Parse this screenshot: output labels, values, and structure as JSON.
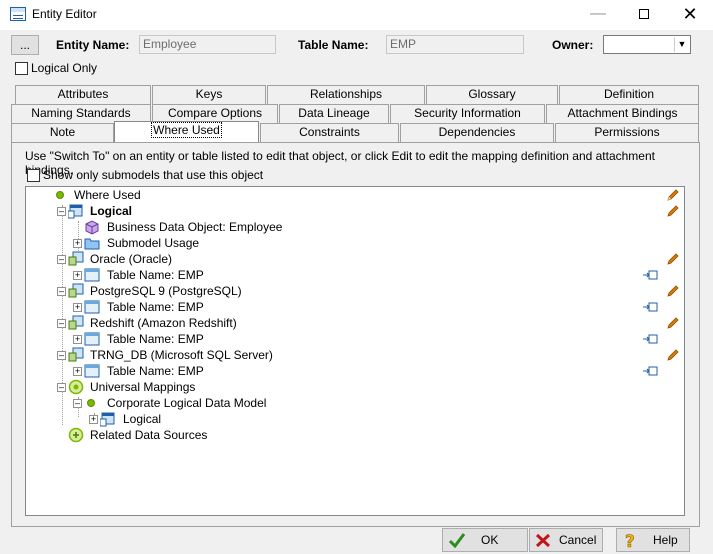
{
  "window": {
    "title": "Entity Editor"
  },
  "header": {
    "browse_label": "...",
    "entity_name_label": "Entity Name:",
    "entity_name_value": "Employee",
    "table_name_label": "Table Name:",
    "table_name_value": "EMP",
    "owner_label": "Owner:",
    "owner_value": "",
    "logical_only_label": "Logical Only"
  },
  "tabs": {
    "row1": [
      "Attributes",
      "Keys",
      "Relationships",
      "Glossary",
      "Definition"
    ],
    "row2": [
      "Naming Standards",
      "Compare Options",
      "Data Lineage",
      "Security Information",
      "Attachment Bindings"
    ],
    "row3": [
      "Note",
      "Where Used",
      "Constraints",
      "Dependencies",
      "Permissions"
    ],
    "active": "Where Used"
  },
  "panel": {
    "hint": "Use \"Switch To\" on an entity or table listed to edit that object, or click Edit to edit the mapping definition and attachment bindings.",
    "show_submodels_label": "Show only submodels that use this object"
  },
  "tree": [
    "Where Used",
    "Logical",
    "Business Data Object: Employee",
    "Submodel Usage",
    "Oracle (Oracle)",
    "Table Name: EMP",
    "PostgreSQL 9 (PostgreSQL)",
    "Table Name: EMP",
    "Redshift (Amazon Redshift)",
    "Table Name: EMP",
    "TRNG_DB (Microsoft SQL Server)",
    "Table Name: EMP",
    "Universal Mappings",
    "Corporate Logical Data Model",
    "Logical",
    "Related Data Sources"
  ],
  "footer": {
    "ok": "OK",
    "cancel": "Cancel",
    "help": "Help"
  },
  "colors": {
    "accent": "#7ab800",
    "pencil": "#e07b00",
    "link": "#1f5fa8"
  }
}
